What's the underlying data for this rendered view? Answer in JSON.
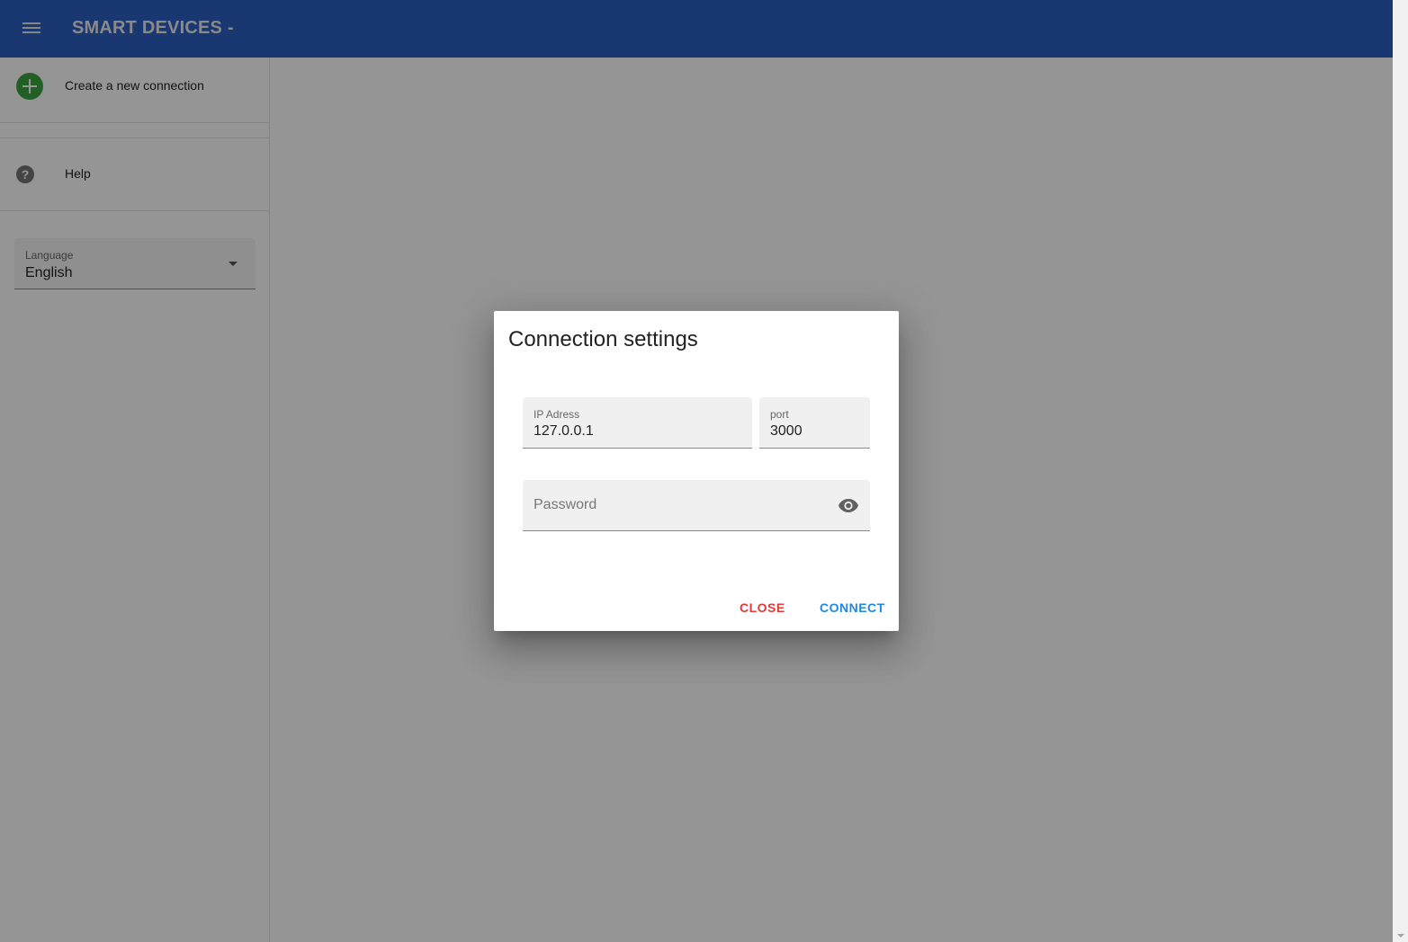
{
  "header": {
    "title": "SMART DEVICES -",
    "menu_icon": "menu-icon",
    "color": "#2c5fc2"
  },
  "sidebar": {
    "items": [
      {
        "label": "Create a new connection",
        "icon": "add-circle-icon"
      },
      {
        "label": "Help",
        "icon": "help-icon"
      }
    ],
    "help_glyph": "?",
    "language": {
      "label": "Language",
      "value": "English"
    }
  },
  "dialog": {
    "title": "Connection settings",
    "ip": {
      "label": "IP Adress",
      "value": "127.0.0.1"
    },
    "port": {
      "label": "port",
      "value": "3000"
    },
    "password": {
      "placeholder": "Password",
      "icon": "eye-icon"
    },
    "close_label": "CLOSE",
    "connect_label": "CONNECT"
  },
  "colors": {
    "accent_add": "#3aa33e",
    "close": "#e53935",
    "connect": "#1e88e5"
  }
}
